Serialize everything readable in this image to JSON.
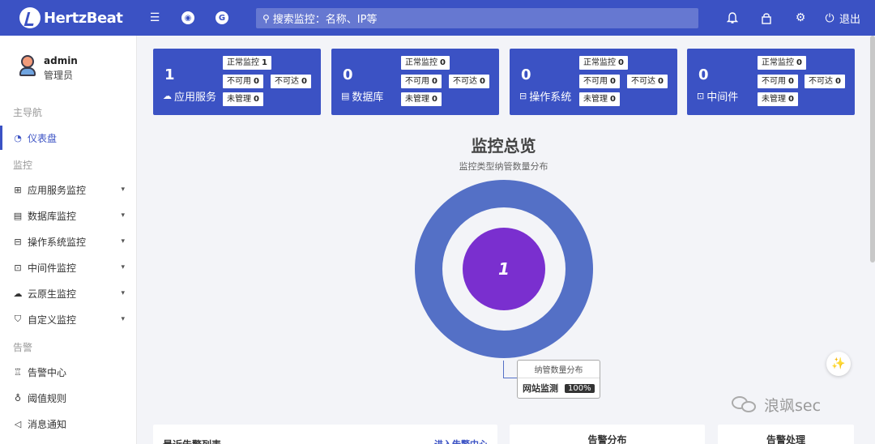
{
  "header": {
    "logo_text": "HertzBeat",
    "search_placeholder": "搜索监控：名称、IP等",
    "logout_label": "退出",
    "icons": [
      "menu-icon",
      "github-icon",
      "gitee-icon",
      "bell-icon",
      "lock-icon",
      "gear-icon",
      "logout-icon"
    ]
  },
  "user": {
    "name": "admin",
    "role": "管理员"
  },
  "sidebar": {
    "groups": {
      "main": "主导航",
      "monitor": "监控",
      "alert": "告警"
    },
    "items": [
      {
        "label": "仪表盘",
        "icon": "dashboard-icon",
        "active": true
      },
      {
        "label": "应用服务监控",
        "icon": "app-grid-icon"
      },
      {
        "label": "数据库监控",
        "icon": "database-icon"
      },
      {
        "label": "操作系统监控",
        "icon": "os-icon"
      },
      {
        "label": "中间件监控",
        "icon": "middleware-icon"
      },
      {
        "label": "云原生监控",
        "icon": "cloud-icon"
      },
      {
        "label": "自定义监控",
        "icon": "shirt-icon"
      },
      {
        "label": "告警中心",
        "icon": "alarm-light-icon"
      },
      {
        "label": "阈值规则",
        "icon": "bulb-icon"
      },
      {
        "label": "消息通知",
        "icon": "notification-icon"
      }
    ]
  },
  "cards": [
    {
      "count": "1",
      "name": "应用服务",
      "icon": "cloud-icon",
      "normal": "正常监控",
      "normal_v": "1",
      "unavail": "不可用",
      "unavail_v": "0",
      "unreach": "不可达",
      "unreach_v": "0",
      "unmanaged": "未管理",
      "unmanaged_v": "0"
    },
    {
      "count": "0",
      "name": "数据库",
      "icon": "database-icon",
      "normal": "正常监控",
      "normal_v": "0",
      "unavail": "不可用",
      "unavail_v": "0",
      "unreach": "不可达",
      "unreach_v": "0",
      "unmanaged": "未管理",
      "unmanaged_v": "0"
    },
    {
      "count": "0",
      "name": "操作系统",
      "icon": "os-icon",
      "normal": "正常监控",
      "normal_v": "0",
      "unavail": "不可用",
      "unavail_v": "0",
      "unreach": "不可达",
      "unreach_v": "0",
      "unmanaged": "未管理",
      "unmanaged_v": "0"
    },
    {
      "count": "0",
      "name": "中间件",
      "icon": "middleware-icon",
      "normal": "正常监控",
      "normal_v": "0",
      "unavail": "不可用",
      "unavail_v": "0",
      "unreach": "不可达",
      "unreach_v": "0",
      "unmanaged": "未管理",
      "unmanaged_v": "0"
    }
  ],
  "overview": {
    "title": "监控总览",
    "subtitle": "监控类型纳管数量分布",
    "center_value": "1",
    "tooltip_title": "纳管数量分布",
    "tooltip_name": "网站监测",
    "tooltip_pct": "100%",
    "colors": {
      "outer": "#5470c6",
      "inner": "#7a2fcf"
    }
  },
  "chart_data": {
    "type": "pie",
    "title": "监控总览",
    "subtitle": "监控类型纳管数量分布",
    "series": [
      {
        "name": "纳管数量分布",
        "values": [
          1
        ]
      }
    ],
    "categories": [
      "网站监测"
    ],
    "percent": [
      "100%"
    ]
  },
  "panels": {
    "recent_alerts": "最近告警列表",
    "goto_alert_center": "进入告警中心",
    "alert_distribution": "告警分布",
    "alert_handling": "告警处理"
  },
  "watermark": "浪飒sec",
  "colors": {
    "primary": "#3b52c4",
    "background": "#f3f4f8"
  }
}
